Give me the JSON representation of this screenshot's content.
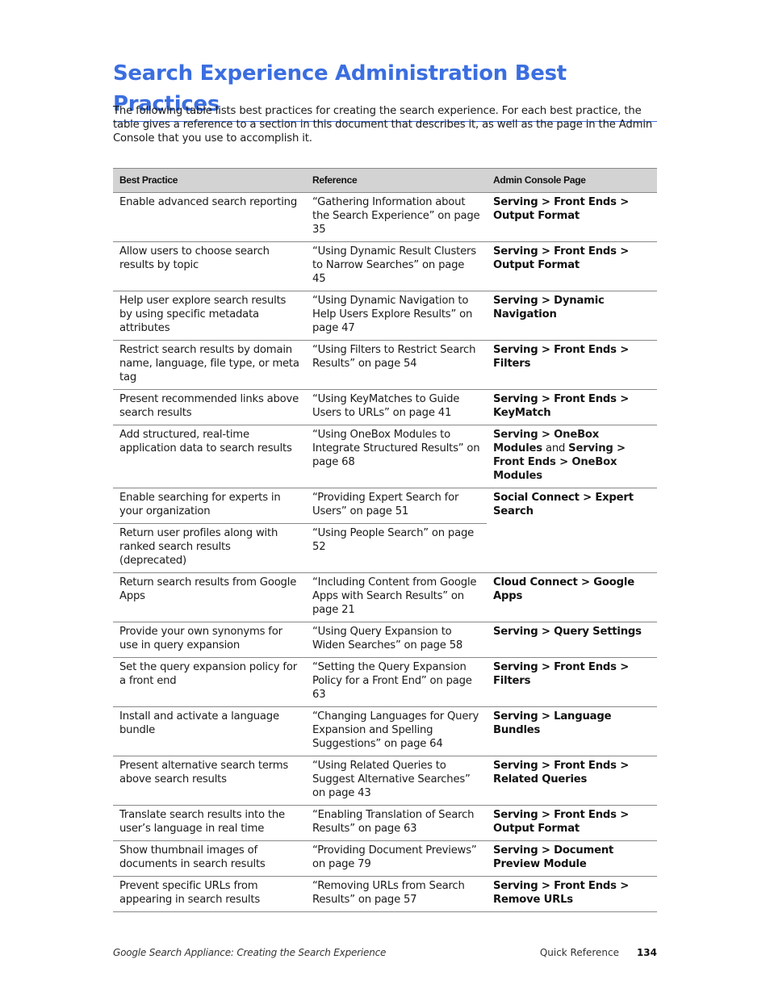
{
  "page": {
    "title": "Search Experience Administration Best Practices",
    "intro": "The following table lists best practices for creating the search experience. For each best practice, the table gives a reference to a section in this document that describes it, as well as the page in the Admin Console that you use to accomplish it."
  },
  "table": {
    "headers": [
      "Best Practice",
      "Reference",
      "Admin Console Page"
    ],
    "rows": [
      {
        "practice": "Enable advanced search reporting",
        "reference": "“Gathering Information about the Search Experience” on page 35",
        "console": "Serving > Front Ends > Output Format"
      },
      {
        "practice": "Allow users to choose search results by topic",
        "reference": "“Using Dynamic Result Clusters to Narrow Searches” on page 45",
        "console": "Serving > Front Ends > Output Format"
      },
      {
        "practice": "Help user explore search results by using specific metadata attributes",
        "reference": "“Using Dynamic Navigation to Help Users Explore Results” on page 47",
        "console": "Serving > Dynamic Navigation"
      },
      {
        "practice": "Restrict search results by domain name, language, file type, or meta tag",
        "reference": "“Using Filters to Restrict Search Results” on page 54",
        "console": "Serving > Front Ends > Filters"
      },
      {
        "practice": "Present recommended links above search results",
        "reference": "“Using KeyMatches to Guide Users to URLs” on page 41",
        "console": "Serving > Front Ends > KeyMatch"
      },
      {
        "practice": "Add structured, real-time application data to search results",
        "reference": "“Using OneBox Modules to Integrate Structured Results” on page 68",
        "console_parts": {
          "a": "Serving > OneBox Modules",
          "and": "and",
          "b": "Serving > Front Ends > OneBox Modules"
        }
      },
      {
        "practice": "Enable searching for experts in your organization",
        "reference": "“Providing Expert Search for Users” on page 51",
        "console": "Social Connect > Expert Search"
      },
      {
        "practice": "Return user profiles along with ranked search results (deprecated)",
        "reference": "“Using People Search” on page 52",
        "console": ""
      },
      {
        "practice": "Return search results from Google Apps",
        "reference": "“Including Content from Google Apps with Search Results” on page 21",
        "console": "Cloud Connect > Google Apps"
      },
      {
        "practice": "Provide your own synonyms for use in query expansion",
        "reference": "“Using Query Expansion to Widen Searches” on page 58",
        "console": "Serving > Query Settings"
      },
      {
        "practice": "Set the query expansion policy for a front end",
        "reference": "“Setting the Query Expansion Policy for a Front End” on page 63",
        "console": "Serving > Front Ends > Filters"
      },
      {
        "practice": "Install and activate a language bundle",
        "reference": "“Changing Languages for Query Expansion and Spelling Suggestions” on page 64",
        "console": "Serving > Language Bundles"
      },
      {
        "practice": "Present alternative search terms above search results",
        "reference": "“Using Related Queries to Suggest Alternative Searches” on page 43",
        "console": "Serving > Front Ends > Related Queries"
      },
      {
        "practice": "Translate search results into the user’s language in real time",
        "reference": "“Enabling Translation of Search Results” on page 63",
        "console": "Serving > Front Ends > Output Format"
      },
      {
        "practice": "Show thumbnail images of documents in search results",
        "reference": "“Providing Document Previews” on page 79",
        "console": "Serving > Document Preview Module"
      },
      {
        "practice": "Prevent specific URLs from appearing in search results",
        "reference": "“Removing URLs from Search Results” on page 57",
        "console": "Serving > Front Ends > Remove URLs"
      }
    ]
  },
  "footer": {
    "document": "Google Search Appliance: Creating the Search Experience",
    "section": "Quick Reference",
    "page_number": "134"
  }
}
